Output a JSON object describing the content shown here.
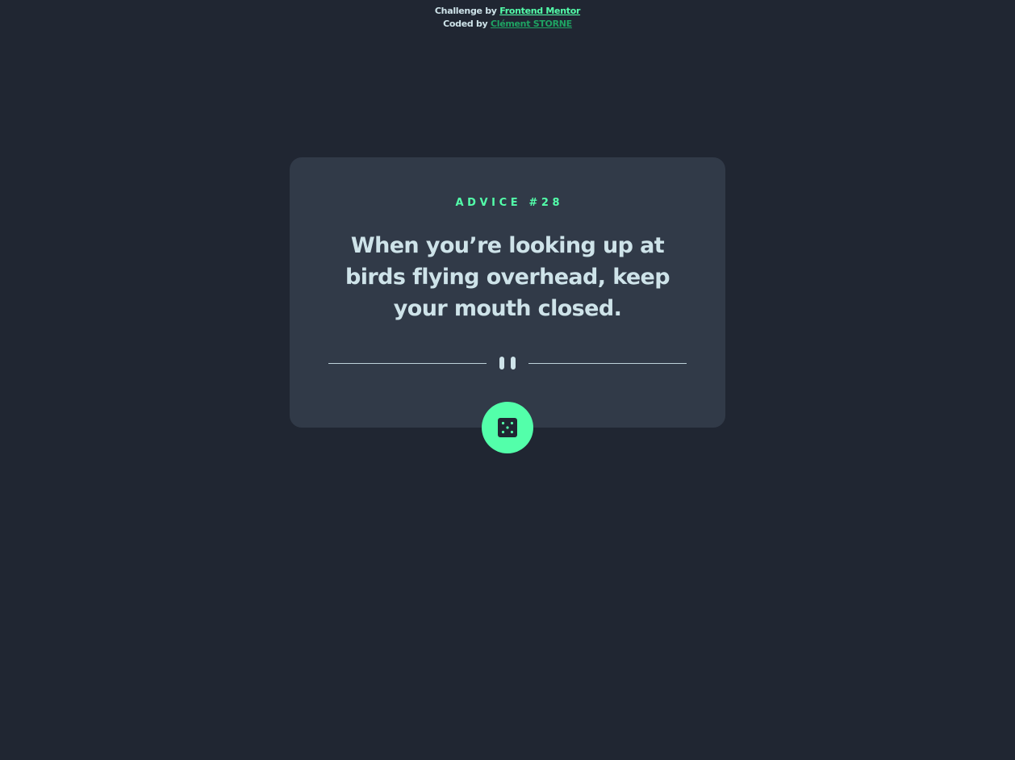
{
  "attribution": {
    "challenge_prefix": "Challenge by",
    "challenge_link": "Frontend Mentor",
    "coded_prefix": "Coded by",
    "author_link": "Clément STORNE"
  },
  "card": {
    "advice_id": "ADVICE #28",
    "advice_text": "When you’re looking up at birds flying overhead, keep your mouth closed.",
    "divider_icon": "pause-icon",
    "button_icon": "dice-icon"
  },
  "colors": {
    "background": "#202632",
    "card": "#313a48",
    "accent": "#53ffaa",
    "text": "#cee3e9",
    "author_link": "#1ea463"
  }
}
